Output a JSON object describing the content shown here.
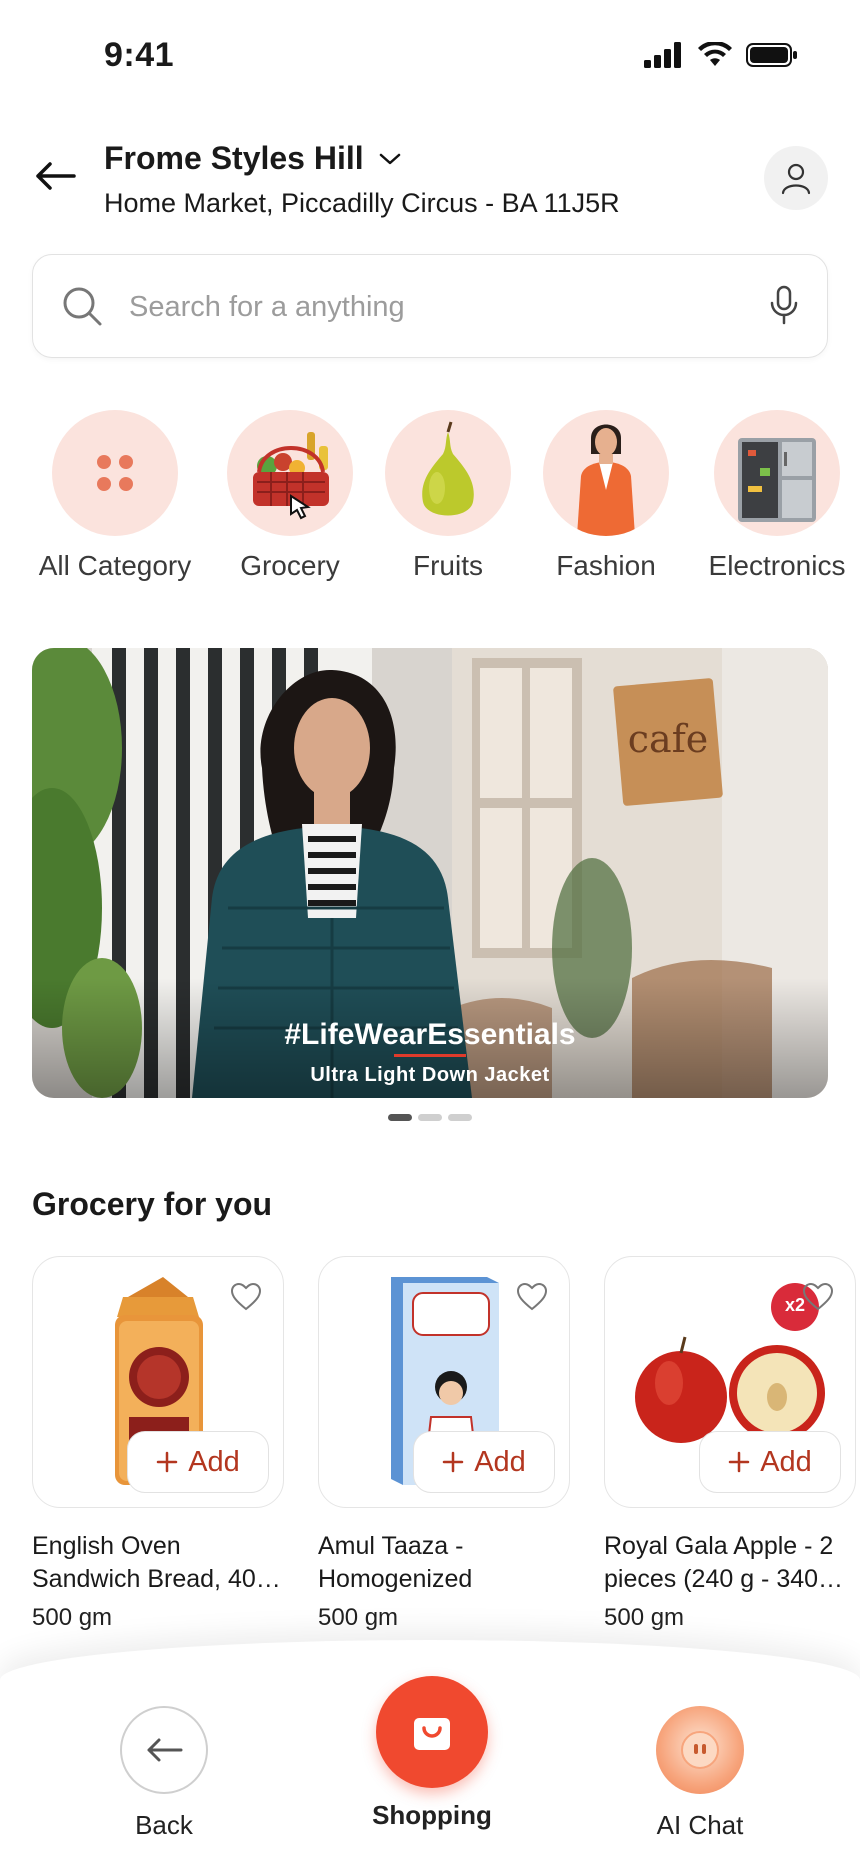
{
  "status": {
    "time": "9:41"
  },
  "header": {
    "title": "Frome Styles Hill",
    "subtitle": "Home Market, Piccadilly Circus - BA 11J5R"
  },
  "search": {
    "placeholder": "Search for a anything"
  },
  "categories": [
    {
      "label": "All Category",
      "icon": "grid-dots-icon"
    },
    {
      "label": "Grocery",
      "icon": "grocery-basket-image"
    },
    {
      "label": "Fruits",
      "icon": "pear-image"
    },
    {
      "label": "Fashion",
      "icon": "fashion-model-image"
    },
    {
      "label": "Electronics",
      "icon": "refrigerator-image"
    }
  ],
  "banner": {
    "hashtag": "#LifeWearEssentials",
    "subtitle": "Ultra Light Down Jacket",
    "sign_text": "cafe",
    "slides": 3,
    "active_slide": 1
  },
  "section": {
    "title": "Grocery for you"
  },
  "products": [
    {
      "name": "English Oven Sandwich Bread, 40…",
      "weight": "500 gm",
      "add_label": "Add"
    },
    {
      "name": "Amul Taaza - Homogenized Toned…",
      "weight": "500 gm",
      "add_label": "Add"
    },
    {
      "name": "Royal Gala Apple - 2 pieces (240 g - 340…",
      "weight": "500 gm",
      "add_label": "Add",
      "badge": "x2"
    }
  ],
  "bottom_nav": {
    "back": "Back",
    "shopping": "Shopping",
    "ai_chat": "AI Chat"
  },
  "colors": {
    "accent": "#b3361f",
    "shopping_button": "#f0492f",
    "category_bg": "#fbe3dd",
    "banner_jacket": "#1f4e57"
  }
}
